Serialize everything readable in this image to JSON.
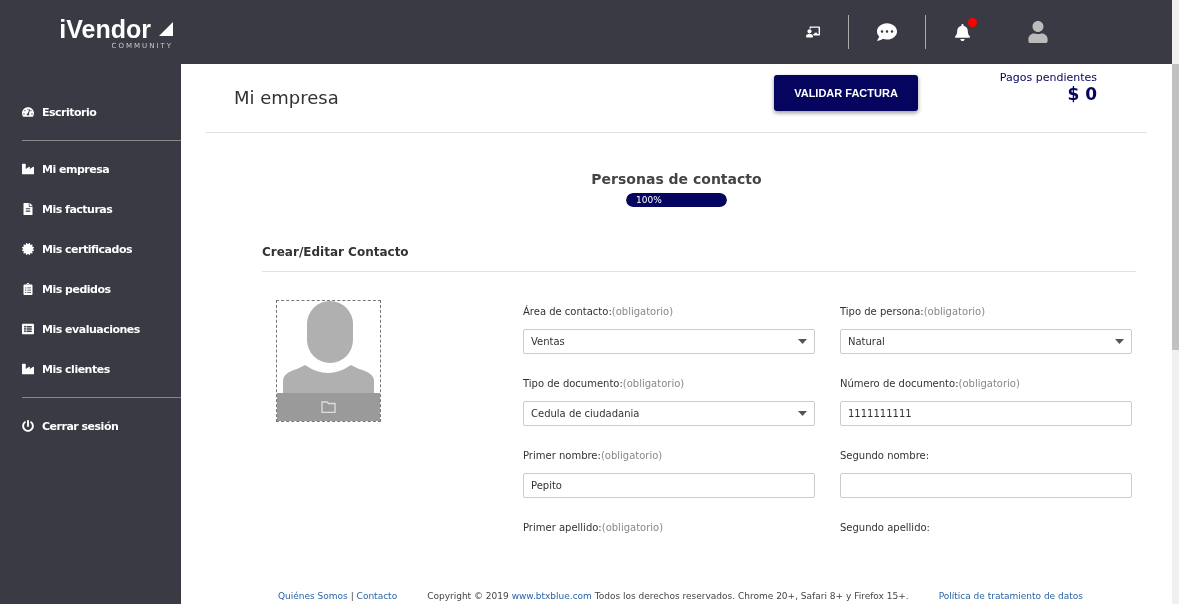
{
  "brand": {
    "name": "iVendor",
    "tagline": "COMMUNITY"
  },
  "topbar": {
    "notification_dot": true
  },
  "sidebar": {
    "groups": [
      [
        {
          "label": "Escritorio"
        }
      ],
      [
        {
          "label": "Mi empresa"
        },
        {
          "label": "Mis facturas"
        },
        {
          "label": "Mis certificados"
        },
        {
          "label": "Mis pedidos"
        },
        {
          "label": "Mis evaluaciones"
        },
        {
          "label": "Mis clientes"
        }
      ],
      [
        {
          "label": "Cerrar sesión"
        }
      ]
    ]
  },
  "page": {
    "title": "Mi empresa",
    "button": "VALIDAR FACTURA",
    "pending_label": "Pagos pendientes",
    "pending_amount": "$ 0"
  },
  "progress": {
    "title": "Personas de contacto",
    "level": 1,
    "reading": "100%"
  },
  "section_title": "Crear/Editar Contacto",
  "fields": [
    {
      "label": "Área de contacto:",
      "hint": "(obligatorio)",
      "kind": "select",
      "value": "Ventas"
    },
    {
      "label": "Tipo de persona:",
      "hint": "(obligatorio)",
      "kind": "select",
      "value": "Natural"
    },
    {
      "label": "Tipo de documento:",
      "hint": "(obligatorio)",
      "kind": "select",
      "value": "Cedula de ciudadania"
    },
    {
      "label": "Número de documento:",
      "hint": "(obligatorio)",
      "kind": "text",
      "value": "1111111111"
    },
    {
      "label": "Primer nombre:",
      "hint": "(obligatorio)",
      "kind": "text",
      "value": "Pepito"
    },
    {
      "label": "Segundo nombre:",
      "kind": "text"
    },
    {
      "label": "Primer apellido:",
      "hint": "(obligatorio)",
      "kind": "label"
    },
    {
      "label": "Segundo apellido:",
      "kind": "label"
    }
  ],
  "footer": {
    "links": [
      "Quiénes Somos",
      "Contacto"
    ],
    "separator": "|",
    "copyright_before": "Copyright © 2019",
    "site": "www.btxblue.com",
    "copyright_after": "Todos los derechos reservados. Chrome 20+, Safari 8+ y Firefox 15+.",
    "policy": "Política de tratamiento de datos"
  }
}
